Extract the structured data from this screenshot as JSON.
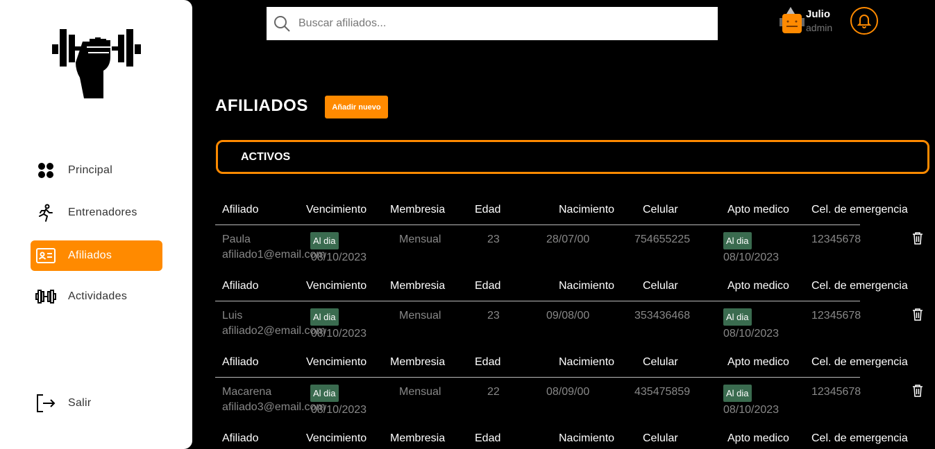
{
  "sidebar": {
    "items": [
      {
        "label": "Principal",
        "icon": "grid-icon"
      },
      {
        "label": "Entrenadores",
        "icon": "runner-icon"
      },
      {
        "label": "Afiliados",
        "icon": "id-card-icon",
        "active": true
      },
      {
        "label": "Actividades",
        "icon": "dumbbell-icon"
      }
    ],
    "logout": "Salir"
  },
  "search": {
    "placeholder": "Buscar afiliados...",
    "value": ""
  },
  "user": {
    "name": "Julio",
    "role": "admin"
  },
  "page": {
    "title": "AFILIADOS",
    "add_label": "Añadir nuevo",
    "section": "ACTIVOS"
  },
  "columns": [
    "Afiliado",
    "Vencimiento",
    "Membresia",
    "Edad",
    "Nacimiento",
    "Celular",
    "Apto medico",
    "Cel. de emergencia"
  ],
  "rows": [
    {
      "name": "Paula",
      "email": "afiliado1@email.com",
      "status": "Al dia",
      "vencimiento": "08/10/2023",
      "membresia": "Mensual",
      "edad": "23",
      "nacimiento": "28/07/00",
      "celular": "754655225",
      "apto_status": "Al dia",
      "apto_fecha": "08/10/2023",
      "emergencia": "12345678"
    },
    {
      "name": "Luis",
      "email": "afiliado2@email.com",
      "status": "Al dia",
      "vencimiento": "08/10/2023",
      "membresia": "Mensual",
      "edad": "23",
      "nacimiento": "09/08/00",
      "celular": "353436468",
      "apto_status": "Al dia",
      "apto_fecha": "08/10/2023",
      "emergencia": "12345678"
    },
    {
      "name": "Macarena",
      "email": "afiliado3@email.com",
      "status": "Al dia",
      "vencimiento": "08/10/2023",
      "membresia": "Mensual",
      "edad": "22",
      "nacimiento": "08/09/00",
      "celular": "435475859",
      "apto_status": "Al dia",
      "apto_fecha": "08/10/2023",
      "emergencia": "12345678"
    }
  ],
  "colors": {
    "accent": "#ff8a00",
    "badge": "#3a6b4f",
    "background": "#000000"
  }
}
